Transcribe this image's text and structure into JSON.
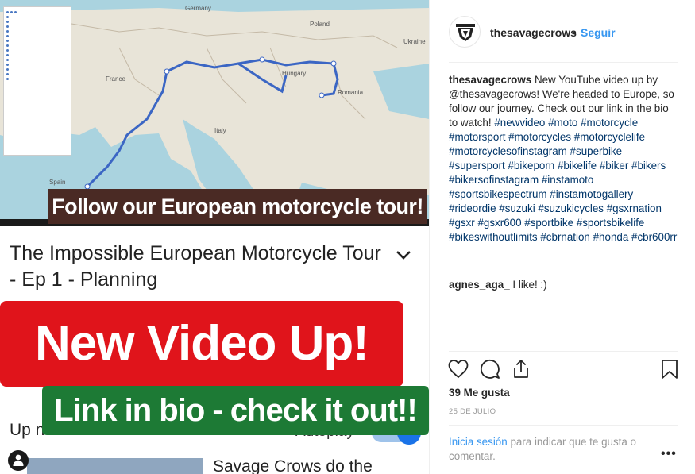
{
  "media": {
    "map_labels": {
      "germany": "Germany",
      "ukraine": "Ukraine",
      "france": "France",
      "romania": "Romania",
      "hungary": "Hungary",
      "spain": "Spain",
      "poland": "Poland",
      "italy": "Italy"
    },
    "banner_follow": "Follow our European motorcycle tour!",
    "video_title": "The Impossible European Motorcycle Tour - Ep 1 - Planning",
    "banner_new_video": "New Video Up!",
    "banner_link": "Link in bio - check it out!!",
    "up_next_label": "Up n",
    "autoplay_label": "Autoplay",
    "next_video_title": "Savage Crows do the"
  },
  "post": {
    "username": "thesavagecrows",
    "separator": "•",
    "follow_label": "Seguir",
    "caption_text": "New YouTube video up by @thesavagecrows! We're headed to Europe, so follow our journey. Check out our link in the bio to watch!",
    "hashtags": "#newvideo #moto #motorcycle #motorsport #motorcycles #motorcyclelife #motorcyclesofinstagram #superbike #supersport #bikeporn #bikelife #biker #bikers #bikersofinstagram #instamoto #sportsbikespectrum #instamotogallery #rideordie #suzuki #suzukicycles #gsxrnation #gsxr #gsxr600 #sportbike #sportsbikelife #bikeswithoutlimits #cbrnation #honda #cbr600rr",
    "comment_user": "agnes_aga_",
    "comment_text": "I like! :)",
    "likes": "39 Me gusta",
    "date": "25 DE JULIO",
    "login_link": "Inicia sesión",
    "login_text": "para indicar que te gusta o comentar.",
    "more_label": "•••"
  },
  "icons": {
    "like": "heart-icon",
    "comment": "comment-icon",
    "share": "share-icon",
    "save": "bookmark-icon"
  },
  "colors": {
    "link": "#3897f0",
    "hashtag": "#003569",
    "banner_red": "#e0141b",
    "banner_green": "#1d7a35"
  }
}
